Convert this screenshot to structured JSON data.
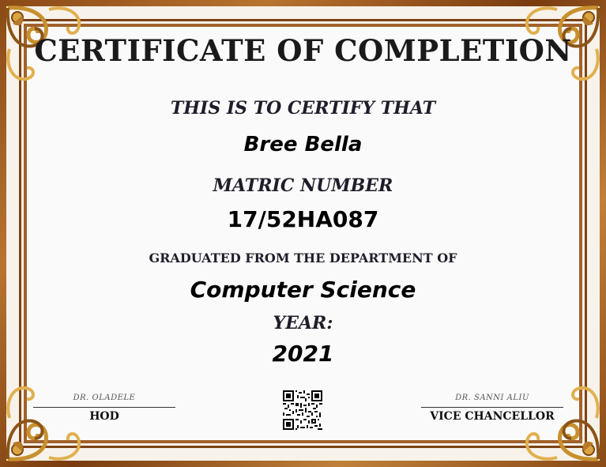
{
  "certificate": {
    "title": "CERTIFICATE OF COMPLETION",
    "certify_text": "THIS IS TO CERTIFY THAT",
    "recipient_name": "Bree Bella",
    "matric_label": "MATRIC NUMBER",
    "matric_number": "17/52HA087",
    "department_label": "GRADUATED FROM THE DEPARTMENT OF",
    "department": "Computer Science",
    "year_label": "YEAR:",
    "year": "2021"
  },
  "signatures": {
    "left": {
      "name": "DR. OLADELE",
      "title": "HOD"
    },
    "right": {
      "name": "DR. SANNI ALIU",
      "title": "VICE CHANCELLOR"
    }
  },
  "colors": {
    "frame_dark": "#7d4313",
    "frame_light": "#c0803a",
    "gold": "#d9a441",
    "background": "#fafafa"
  },
  "icons": {
    "corners": "ornamental-scroll-icon",
    "qr": "qr-code-icon"
  }
}
